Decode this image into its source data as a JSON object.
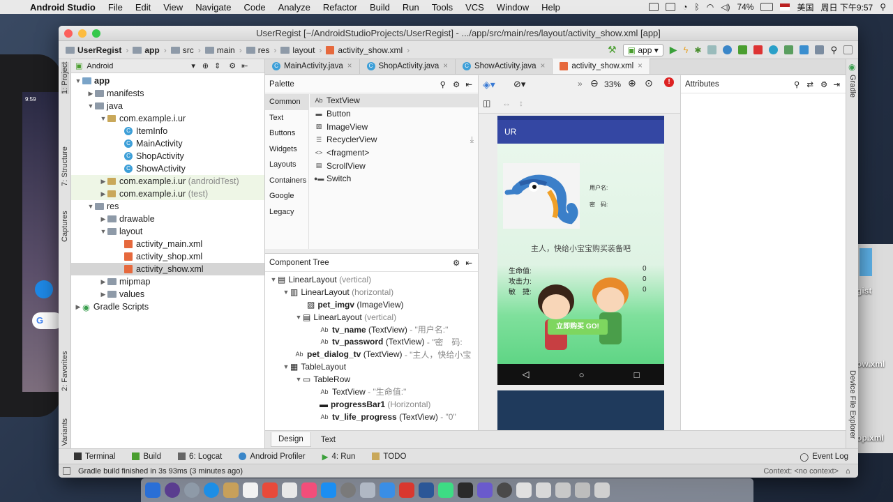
{
  "menubar": {
    "app": "Android Studio",
    "items": [
      "File",
      "Edit",
      "View",
      "Navigate",
      "Code",
      "Analyze",
      "Refactor",
      "Build",
      "Run",
      "Tools",
      "VCS",
      "Window",
      "Help"
    ],
    "battery": "74%",
    "input_source": "美国",
    "clock": "周日 下午9:57"
  },
  "desktop": {
    "file1": "gist",
    "file2": "ow.xml",
    "file3": "op.xml",
    "emu_time": "9:59"
  },
  "window": {
    "title": "UserRegist [~/AndroidStudioProjects/UserRegist] - .../app/src/main/res/layout/activity_show.xml [app]"
  },
  "breadcrumb": [
    "UserRegist",
    "app",
    "src",
    "main",
    "res",
    "layout",
    "activity_show.xml"
  ],
  "run_config": "app",
  "left_strip": {
    "project": "1: Project",
    "structure": "7: Structure",
    "captures": "Captures",
    "favorites": "2: Favorites",
    "build_variants": "Build Variants"
  },
  "right_strip": {
    "gradle": "Gradle",
    "device_explorer": "Device File Explorer"
  },
  "project_panel": {
    "view": "Android",
    "tree": {
      "app": "app",
      "manifests": "manifests",
      "java": "java",
      "pkg": "com.example.i.ur",
      "c1": "ItemInfo",
      "c2": "MainActivity",
      "c3": "ShopActivity",
      "c4": "ShowActivity",
      "pkg_test_a": "com.example.i.ur",
      "tag_android": "(androidTest)",
      "pkg_test_b": "com.example.i.ur",
      "tag_test": "(test)",
      "res": "res",
      "drawable": "drawable",
      "layout": "layout",
      "x1": "activity_main.xml",
      "x2": "activity_shop.xml",
      "x3": "activity_show.xml",
      "mipmap": "mipmap",
      "values": "values",
      "gradle": "Gradle Scripts"
    }
  },
  "editor_tabs": [
    "MainActivity.java",
    "ShopActivity.java",
    "ShowActivity.java",
    "activity_show.xml"
  ],
  "palette": {
    "title": "Palette",
    "categories": [
      "Common",
      "Text",
      "Buttons",
      "Widgets",
      "Layouts",
      "Containers",
      "Google",
      "Legacy"
    ],
    "items": [
      "TextView",
      "Button",
      "ImageView",
      "RecyclerView",
      "<fragment>",
      "ScrollView",
      "Switch"
    ],
    "icon_ab": "Ab"
  },
  "design_toolbar": {
    "zoom": "33%"
  },
  "component_tree": {
    "title": "Component Tree",
    "r1": "LinearLayout",
    "r1t": "(vertical)",
    "r2": "LinearLayout",
    "r2t": "(horizontal)",
    "r3": "pet_imgv",
    "r3t": "(ImageView)",
    "r4": "LinearLayout",
    "r4t": "(vertical)",
    "r5": "tv_name",
    "r5t": "(TextView)",
    "r5v": "- \"用户名:\"",
    "r6": "tv_password",
    "r6t": "(TextView)",
    "r6v": "- \"密　码:",
    "r7": "pet_dialog_tv",
    "r7t": "(TextView)",
    "r7v": "- \"主人，快给小宝",
    "r8": "TableLayout",
    "r9": "TableRow",
    "r10": "TextView",
    "r10v": "- \"生命值:\"",
    "r11": "progressBar1",
    "r11t": "(Horizontal)",
    "r12": "tv_life_progress",
    "r12t": "(TextView)",
    "r12v": "- \"0\""
  },
  "bottom_tabs": [
    "Design",
    "Text"
  ],
  "attributes": {
    "title": "Attributes"
  },
  "preview": {
    "app_title": "UR",
    "username_label": "用户名:",
    "password_label": "密　码:",
    "dialog": "主人，快给小宝宝购买装备吧",
    "life": "生命值:",
    "attack": "攻击力:",
    "agility": "敏　捷:",
    "v_life": "0",
    "v_attack": "0",
    "v_agility": "0",
    "buy_button": "立即购买 GO!"
  },
  "tool_windows": [
    "Terminal",
    "Build",
    "6: Logcat",
    "Android Profiler",
    "4: Run",
    "TODO",
    "Event Log"
  ],
  "status": {
    "message": "Gradle build finished in 3s 93ms (3 minutes ago)",
    "context": "Context: <no context>"
  }
}
